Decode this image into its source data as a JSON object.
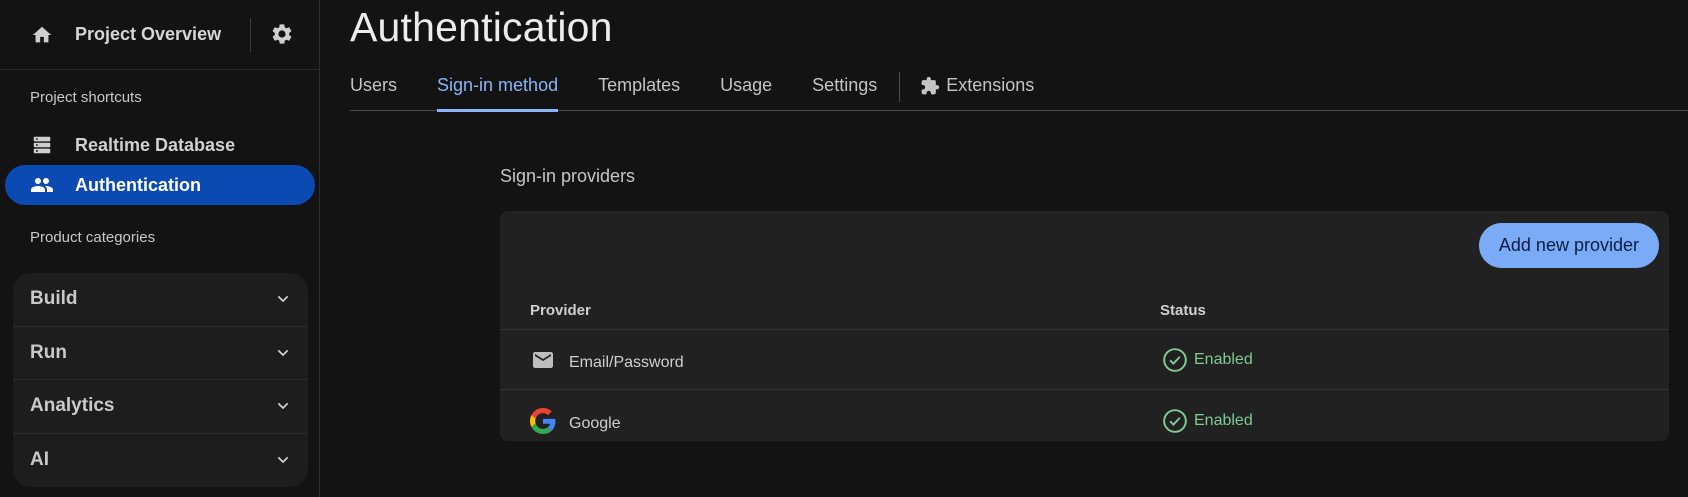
{
  "sidebar": {
    "project_overview": "Project Overview",
    "shortcuts_label": "Project shortcuts",
    "shortcuts": [
      {
        "label": "Realtime Database",
        "icon": "database-icon"
      },
      {
        "label": "Authentication",
        "icon": "people-icon",
        "active": true
      }
    ],
    "categories_label": "Product categories",
    "categories": [
      {
        "label": "Build"
      },
      {
        "label": "Run"
      },
      {
        "label": "Analytics"
      },
      {
        "label": "AI"
      }
    ]
  },
  "main": {
    "title": "Authentication",
    "tabs": [
      {
        "label": "Users"
      },
      {
        "label": "Sign-in method",
        "active": true
      },
      {
        "label": "Templates"
      },
      {
        "label": "Usage"
      },
      {
        "label": "Settings"
      },
      {
        "label": "Extensions",
        "icon": "extensions-icon"
      }
    ],
    "section_title": "Sign-in providers",
    "add_button": "Add new provider",
    "table": {
      "columns": [
        "Provider",
        "Status"
      ],
      "rows": [
        {
          "provider": "Email/Password",
          "icon": "mail-icon",
          "status": "Enabled"
        },
        {
          "provider": "Google",
          "icon": "google-icon",
          "status": "Enabled"
        }
      ]
    }
  },
  "colors": {
    "accent": "#8ab4f8",
    "active_nav": "#0b49b3",
    "enabled": "#81c995",
    "button": "#7baaf7"
  }
}
